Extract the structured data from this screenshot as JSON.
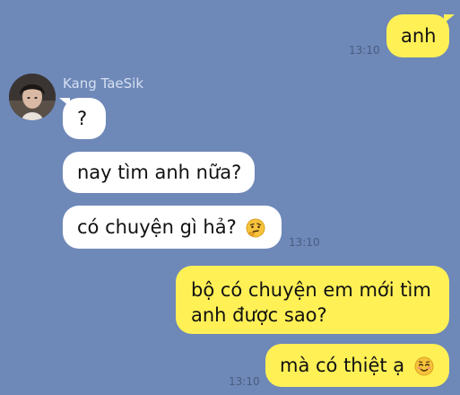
{
  "chat": {
    "sender_name": "Kang TaeSik",
    "messages": [
      {
        "direction": "out",
        "text": "anh",
        "time": "13:10"
      },
      {
        "direction": "in",
        "text": "?"
      },
      {
        "direction": "in",
        "text": "nay tìm anh nữa?"
      },
      {
        "direction": "in",
        "text": "có chuyện gì hả?",
        "emoji": "thinking-face-icon",
        "time": "13:10"
      },
      {
        "direction": "out",
        "line1": "bộ có chuyện em mới tìm",
        "line2": "anh được sao?"
      },
      {
        "direction": "out",
        "text": "mà có thiệt ạ",
        "emoji": "smiling-face-icon",
        "time": "13:10"
      }
    ]
  },
  "colors": {
    "background": "#6e88b8",
    "outgoing_bubble": "#fff056",
    "incoming_bubble": "#ffffff",
    "timestamp": "#4a5d80",
    "sender_name": "#d6e0f2"
  }
}
